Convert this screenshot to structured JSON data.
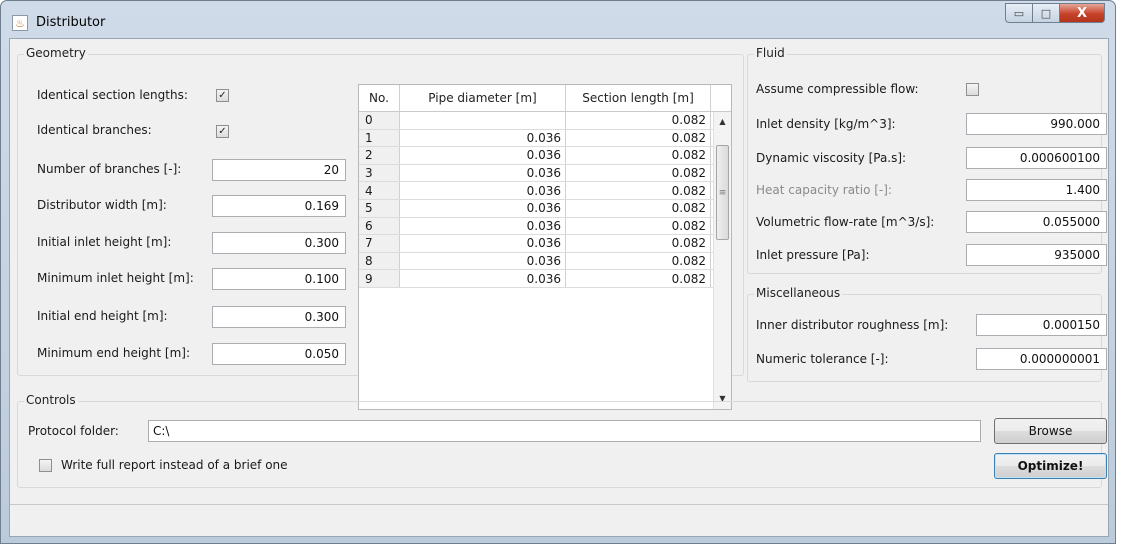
{
  "window": {
    "title": "Distributor",
    "icon": "java-cup-icon",
    "minimize_glyph": "▭",
    "maximize_glyph": "□",
    "close_glyph": "X"
  },
  "geometry": {
    "title": "Geometry",
    "identical_section_lengths": {
      "label": "Identical section lengths:",
      "checked": true
    },
    "identical_branches": {
      "label": "Identical branches:",
      "checked": true
    },
    "fields": [
      {
        "label": "Number of branches [-]:",
        "value": "20"
      },
      {
        "label": "Distributor width [m]:",
        "value": "0.169"
      },
      {
        "label": "Initial inlet height [m]:",
        "value": "0.300"
      },
      {
        "label": "Minimum inlet height [m]:",
        "value": "0.100"
      },
      {
        "label": "Initial end height [m]:",
        "value": "0.300"
      },
      {
        "label": "Minimum end height [m]:",
        "value": "0.050"
      }
    ],
    "table": {
      "headers": [
        "No.",
        "Pipe diameter [m]",
        "Section length [m]"
      ],
      "rows": [
        [
          "0",
          "",
          "0.082"
        ],
        [
          "1",
          "0.036",
          "0.082"
        ],
        [
          "2",
          "0.036",
          "0.082"
        ],
        [
          "3",
          "0.036",
          "0.082"
        ],
        [
          "4",
          "0.036",
          "0.082"
        ],
        [
          "5",
          "0.036",
          "0.082"
        ],
        [
          "6",
          "0.036",
          "0.082"
        ],
        [
          "7",
          "0.036",
          "0.082"
        ],
        [
          "8",
          "0.036",
          "0.082"
        ],
        [
          "9",
          "0.036",
          "0.082"
        ]
      ],
      "scroll_up": "▲",
      "scroll_down": "▼",
      "scroll_grip": "≡"
    }
  },
  "fluid": {
    "title": "Fluid",
    "compressible": {
      "label": "Assume compressible flow:",
      "checked": false
    },
    "fields": [
      {
        "label": "Inlet density [kg/m^3]:",
        "value": "990.000",
        "enabled": true
      },
      {
        "label": "Dynamic viscosity [Pa.s]:",
        "value": "0.000600100",
        "enabled": true
      },
      {
        "label": "Heat capacity ratio [-]:",
        "value": "1.400",
        "enabled": false
      },
      {
        "label": "Volumetric flow-rate [m^3/s]:",
        "value": "0.055000",
        "enabled": true
      },
      {
        "label": "Inlet pressure [Pa]:",
        "value": "935000",
        "enabled": true
      }
    ]
  },
  "misc": {
    "title": "Miscellaneous",
    "fields": [
      {
        "label": "Inner distributor roughness [m]:",
        "value": "0.000150"
      },
      {
        "label": "Numeric tolerance [-]:",
        "value": "0.000000001"
      }
    ]
  },
  "controls": {
    "title": "Controls",
    "protocol_label": "Protocol folder:",
    "protocol_value": "C:\\",
    "browse_label": "Browse",
    "full_report": {
      "label": "Write full report instead of a brief one",
      "checked": false
    },
    "optimize_label": "Optimize!"
  },
  "status": {
    "text": ""
  }
}
